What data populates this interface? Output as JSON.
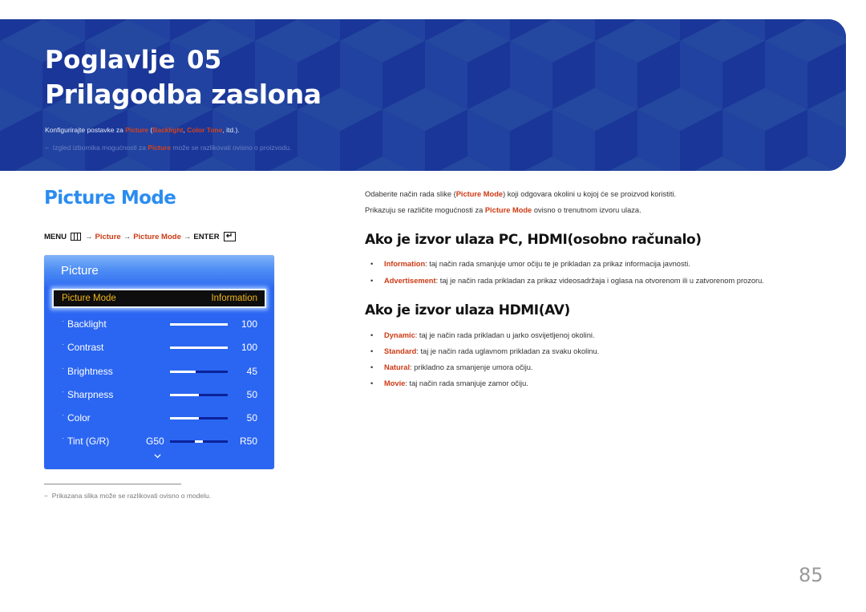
{
  "header": {
    "chapter_label": "Poglavlje",
    "chapter_number": "05",
    "title": "Prilagodba zaslona",
    "desc_prefix": "Konfigurirajte postavke za ",
    "desc_picture": "Picture",
    "desc_open": " (",
    "desc_backlight": "Backlight",
    "desc_comma": ", ",
    "desc_colortone": "Color Tone",
    "desc_suffix": ", itd.).",
    "note_dash": "−",
    "note_prefix": "Izgled izbornika mogućnosti za ",
    "note_picture": "Picture",
    "note_suffix": " može se razlikovati ovisno o proizvodu."
  },
  "section": {
    "title": "Picture Mode",
    "menu_path": {
      "menu": "MENU",
      "arrow": "→",
      "step1": "Picture",
      "step2": "Picture Mode",
      "enter": "ENTER",
      "enter_glyph": "↵"
    }
  },
  "osd": {
    "title": "Picture",
    "selected_label": "Picture Mode",
    "selected_value": "Information",
    "bullet": "·",
    "rows": [
      {
        "label": "Backlight",
        "value": "100",
        "fraction": 1.0
      },
      {
        "label": "Contrast",
        "value": "100",
        "fraction": 1.0
      },
      {
        "label": "Brightness",
        "value": "45",
        "fraction": 0.45
      },
      {
        "label": "Sharpness",
        "value": "50",
        "fraction": 0.5
      },
      {
        "label": "Color",
        "value": "50",
        "fraction": 0.5
      }
    ],
    "tint": {
      "label": "Tint (G/R)",
      "left": "G50",
      "right": "R50",
      "position": 0.5
    },
    "more_icon": "chevron-down"
  },
  "footnote": {
    "dash": "−",
    "text": "Prikazana slika može se razlikovati ovisno o modelu."
  },
  "right": {
    "intro1_prefix": "Odaberite način rada slike (",
    "intro1_term": "Picture Mode",
    "intro1_suffix": ") koji odgovara okolini u kojoj će se proizvod koristiti.",
    "intro2_prefix": "Prikazuju se različite mogućnosti za ",
    "intro2_term": "Picture Mode",
    "intro2_suffix": " ovisno o trenutnom izvoru ulaza.",
    "pc_title": "Ako je izvor ulaza PC, HDMI(osobno računalo)",
    "pc_items": [
      {
        "term": "Information",
        "text": ": taj način rada smanjuje umor očiju te je prikladan za prikaz informacija javnosti."
      },
      {
        "term": "Advertisement",
        "text": ": taj je način rada prikladan za prikaz videosadržaja i oglasa na otvorenom ili u zatvorenom prozoru."
      }
    ],
    "av_title": "Ako je izvor ulaza HDMI(AV)",
    "av_items": [
      {
        "term": "Dynamic",
        "text": ": taj je način rada prikladan u jarko osvijetljenoj okolini."
      },
      {
        "term": "Standard",
        "text": ": taj je način rada uglavnom prikladan za svaku okolinu."
      },
      {
        "term": "Natural",
        "text": ": prikladno za smanjenje umora očiju."
      },
      {
        "term": "Movie",
        "text": ": taj način rada smanjuje zamor očiju."
      }
    ],
    "bullet": "•"
  },
  "page_number": "85"
}
